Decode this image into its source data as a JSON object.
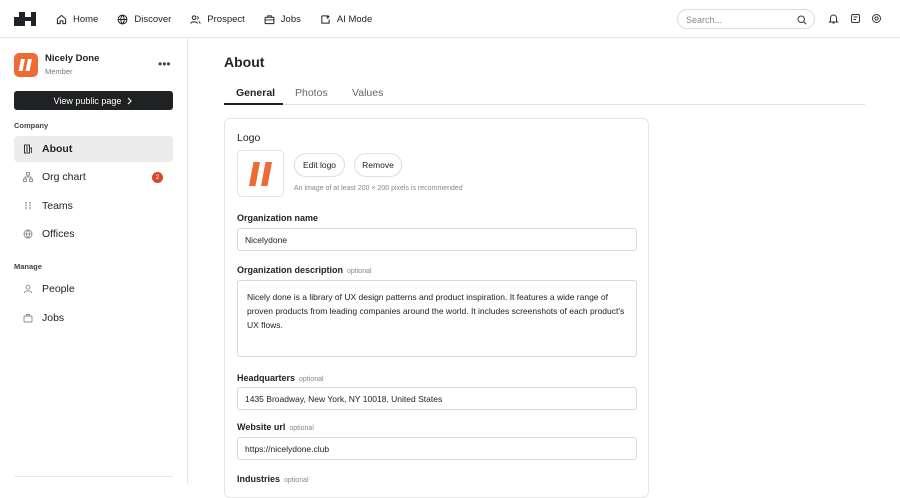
{
  "nav": {
    "items": [
      {
        "label": "Home",
        "icon": "home-icon"
      },
      {
        "label": "Discover",
        "icon": "globe-icon"
      },
      {
        "label": "Prospect",
        "icon": "users-icon"
      },
      {
        "label": "Jobs",
        "icon": "briefcase-icon"
      },
      {
        "label": "AI Mode",
        "icon": "sparkle-icon"
      }
    ],
    "search_placeholder": "Search...",
    "right_icons": [
      "bell-icon",
      "inbox-icon",
      "settings-icon"
    ]
  },
  "sidebar": {
    "org_name": "Nicely Done",
    "org_role": "Member",
    "more_label": "•••",
    "view_public_label": "View public page",
    "company_label": "Company",
    "company_items": [
      {
        "label": "About",
        "icon": "building-icon",
        "active": true
      },
      {
        "label": "Org chart",
        "icon": "org-chart-icon",
        "badge": "2"
      },
      {
        "label": "Teams",
        "icon": "teams-icon"
      },
      {
        "label": "Offices",
        "icon": "globe-icon"
      }
    ],
    "manage_label": "Manage",
    "manage_items": [
      {
        "label": "People",
        "icon": "person-icon"
      },
      {
        "label": "Jobs",
        "icon": "briefcase-icon"
      }
    ]
  },
  "main": {
    "title": "About",
    "tabs": [
      "General",
      "Photos",
      "Values"
    ],
    "form": {
      "logo_label": "Logo",
      "edit_logo_label": "Edit logo",
      "remove_label": "Remove",
      "logo_hint": "An image of at least 200 × 200 pixels is recommended",
      "org_name_label": "Organization name",
      "org_name_value": "Nicelydone",
      "org_desc_label": "Organization description",
      "optional": "optional",
      "org_desc_value": "Nicely done is a library of UX design patterns and product inspiration. It features a wide range of proven products from leading companies around the world. It includes screenshots of each product's UX flows.",
      "hq_label": "Headquarters",
      "hq_value": "1435 Broadway, New York, NY 10018, United States",
      "website_label": "Website url",
      "website_value": "https://nicelydone.club",
      "industries_label": "Industries"
    }
  },
  "colors": {
    "brand": "#f06a35",
    "badge": "#d6492a",
    "dark_button": "#1f2123"
  }
}
